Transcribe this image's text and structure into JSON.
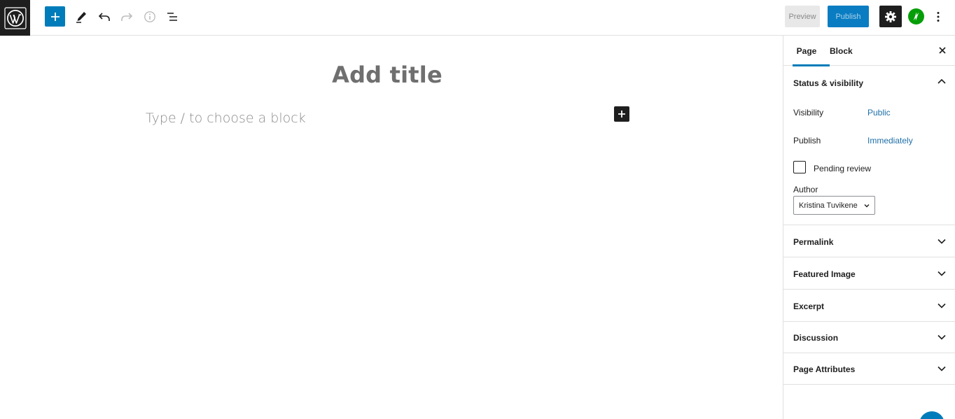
{
  "toolbar": {
    "logo_icon": "wordpress-logo-icon",
    "inserter_icon": "plus-icon",
    "tools_icon": "pencil-icon",
    "undo_icon": "undo-icon",
    "redo_icon": "redo-icon",
    "details_icon": "info-icon",
    "outline_icon": "list-view-icon",
    "preview_label": "Preview",
    "publish_label": "Publish",
    "settings_icon": "gear-icon",
    "jetpack_icon": "jetpack-icon",
    "more_icon": "more-vertical-icon"
  },
  "editor": {
    "title_placeholder": "Add title",
    "block_placeholder": "Type / to choose a block",
    "block_inserter_icon": "plus-icon"
  },
  "sidebar": {
    "tabs": [
      {
        "label": "Page",
        "active": true
      },
      {
        "label": "Block",
        "active": false
      }
    ],
    "close_icon": "close-icon",
    "status_panel": {
      "title": "Status & visibility",
      "expanded": true,
      "visibility_label": "Visibility",
      "visibility_value": "Public",
      "publish_label": "Publish",
      "publish_value": "Immediately",
      "pending_review_label": "Pending review",
      "pending_review_checked": false,
      "author_label": "Author",
      "author_value": "Kristina Tuvikene"
    },
    "panels": [
      {
        "title": "Permalink",
        "expanded": false
      },
      {
        "title": "Featured Image",
        "expanded": false
      },
      {
        "title": "Excerpt",
        "expanded": false
      },
      {
        "title": "Discussion",
        "expanded": false
      },
      {
        "title": "Page Attributes",
        "expanded": false
      }
    ]
  },
  "colors": {
    "accent": "#007cba",
    "publish_button": "#0a7dc2",
    "dark": "#1e1e1e",
    "link": "#1e6fa8",
    "jetpack_green": "#069e08"
  }
}
